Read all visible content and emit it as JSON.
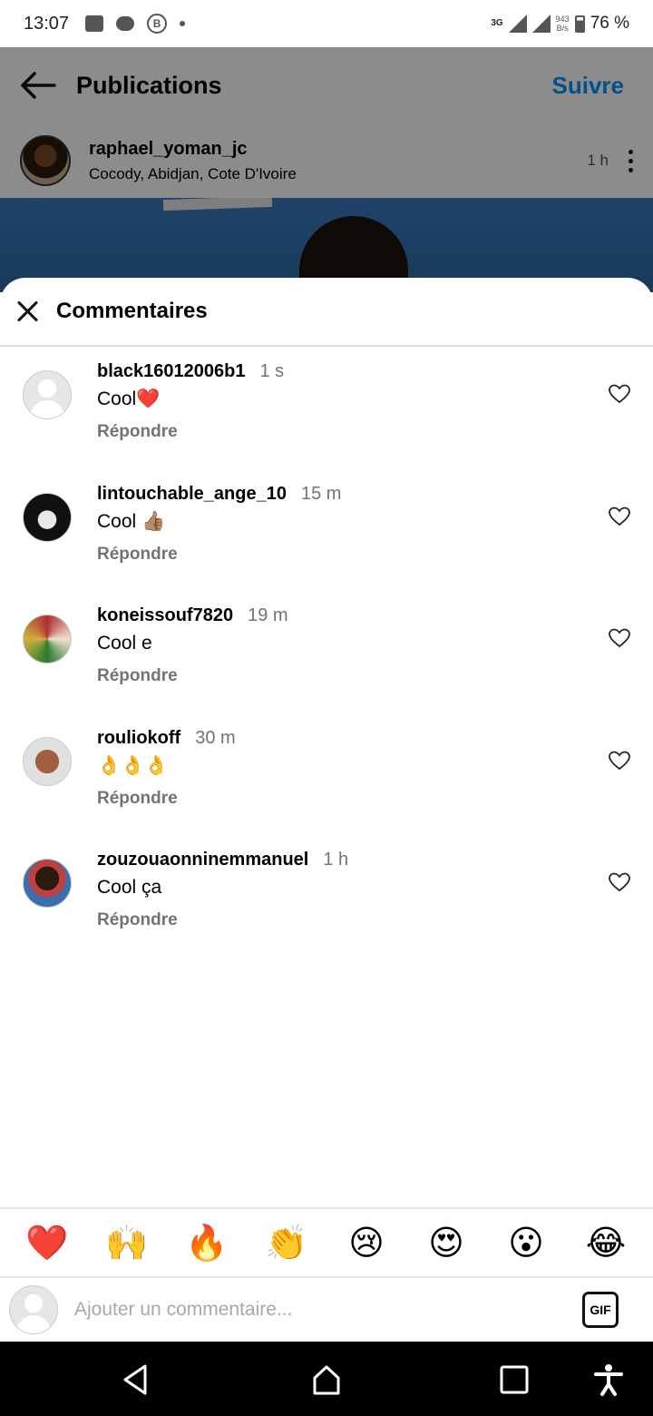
{
  "status_bar": {
    "time": "13:07",
    "network": "3G",
    "speed_value": "943",
    "speed_unit": "B/s",
    "battery": "76 %"
  },
  "header": {
    "title": "Publications",
    "follow_label": "Suivre"
  },
  "post": {
    "username": "raphael_yoman_jc",
    "location": "Cocody, Abidjan, Cote D'Ivoire",
    "time": "1 h"
  },
  "sheet": {
    "title": "Commentaires"
  },
  "comments": [
    {
      "user": "black16012006b1",
      "time": "1 s",
      "text": "Cool❤️",
      "reply": "Répondre"
    },
    {
      "user": "lintouchable_ange_10",
      "time": "15 m",
      "text": "Cool 👍🏽",
      "reply": "Répondre"
    },
    {
      "user": "koneissouf7820",
      "time": "19 m",
      "text": "Cool e",
      "reply": "Répondre"
    },
    {
      "user": "rouliokoff",
      "time": "30 m",
      "text": "👌👌👌",
      "reply": "Répondre"
    },
    {
      "user": "zouzouaonninemmanuel",
      "time": "1 h",
      "text": "Cool ça",
      "reply": "Répondre"
    }
  ],
  "emoji_bar": [
    "❤️",
    "🙌",
    "🔥",
    "👏",
    "😢",
    "😍",
    "😮",
    "😂"
  ],
  "composer": {
    "placeholder": "Ajouter un commentaire...",
    "gif_label": "GIF"
  },
  "colors": {
    "accent": "#0095f6",
    "muted": "#737373"
  }
}
